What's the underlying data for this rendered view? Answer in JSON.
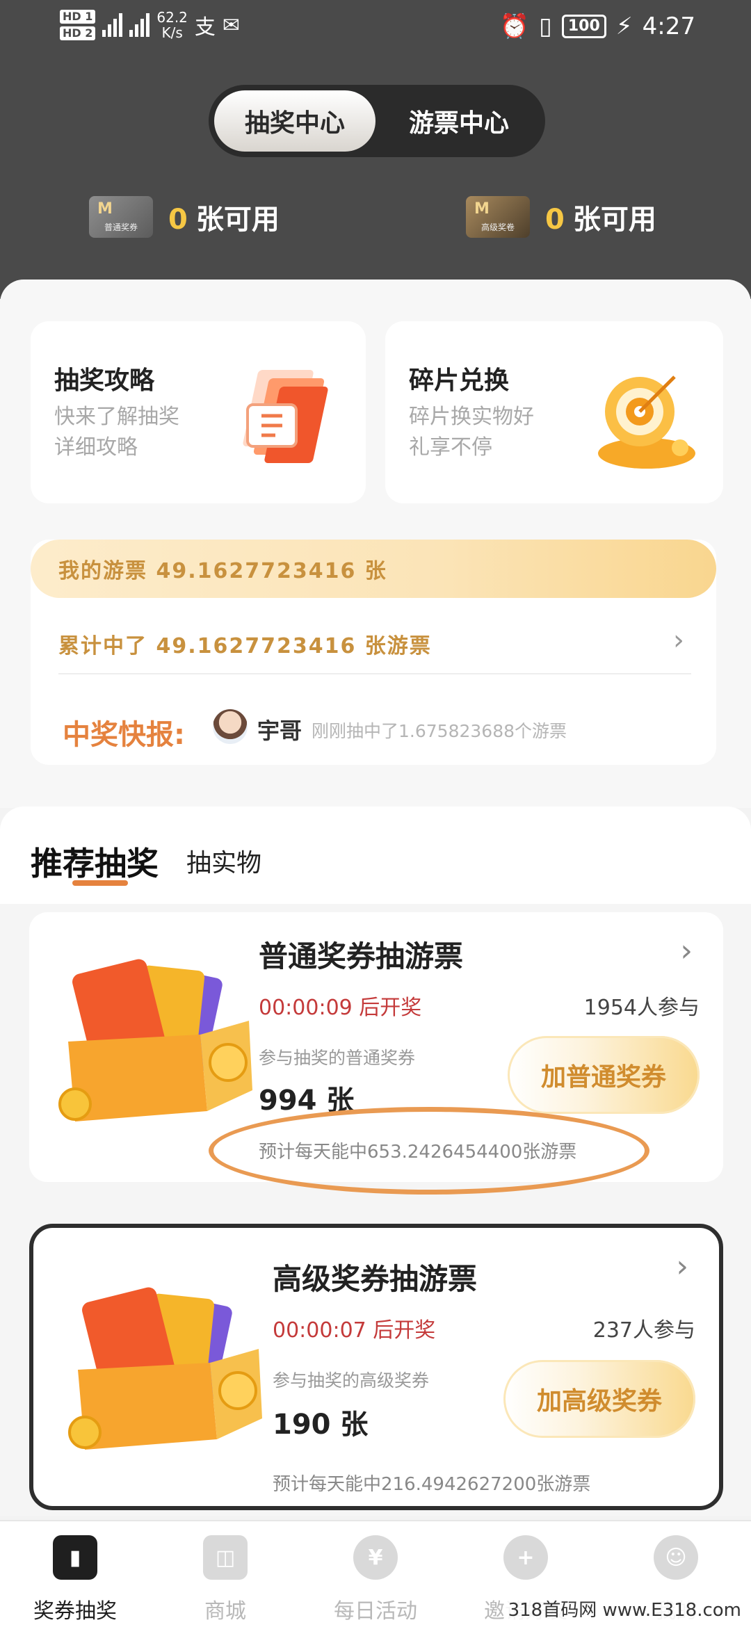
{
  "status": {
    "hd1": "HD 1",
    "hd2": "HD 2",
    "net_speed": "62.2",
    "net_unit": "K/s",
    "alipay": "支",
    "battery": "100",
    "time": "4:27"
  },
  "top_tabs": [
    "抽奖中心",
    "游票中心"
  ],
  "tickets": [
    {
      "icon_label": "普通奖券",
      "count": "0",
      "suffix": "张可用"
    },
    {
      "icon_label": "高级奖卷",
      "count": "0",
      "suffix": "张可用"
    }
  ],
  "cards": {
    "guide": {
      "title": "抽奖攻略",
      "subtitle": "快来了解抽奖详细攻略"
    },
    "exchange": {
      "title": "碎片兑换",
      "subtitle": "碎片换实物好礼享不停"
    }
  },
  "stats": {
    "mine": "我的游票 49.1627723416 张",
    "total": "累计中了 49.1627723416 张游票",
    "news_title": "中奖快报:",
    "news_name": "宇哥",
    "news_text": "刚刚抽中了1.675823688个游票"
  },
  "section": {
    "recommend": "推荐抽奖",
    "physical": "抽实物"
  },
  "lotteries": [
    {
      "name": "普通奖券抽游票",
      "timer": "00:00:09 后开奖",
      "participants": "1954人参与",
      "pool_label": "参与抽奖的普通奖券",
      "pool_value": "994 张",
      "button": "加普通奖券",
      "daily": "预计每天能中653.2426454400张游票"
    },
    {
      "name": "高级奖券抽游票",
      "timer": "00:00:07 后开奖",
      "participants": "237人参与",
      "pool_label": "参与抽奖的高级奖券",
      "pool_value": "190 张",
      "button": "加高级奖券",
      "daily": "预计每天能中216.4942627200张游票"
    }
  ],
  "nav": [
    {
      "label": "奖券抽奖",
      "icon": "ticket-icon"
    },
    {
      "label": "商城",
      "icon": "shop-bag-icon"
    },
    {
      "label": "每日活动",
      "icon": "money-bag-icon"
    },
    {
      "label": "邀请好友",
      "icon": "add-friend-icon"
    },
    {
      "label": "我的",
      "icon": "profile-icon"
    }
  ],
  "watermark": "318首码网 www.E318.com",
  "colors": {
    "accent_orange": "#e5823e",
    "gold_text": "#c8913e",
    "timer_red": "#c43a3a",
    "dark_bg": "#4a4a4a"
  }
}
